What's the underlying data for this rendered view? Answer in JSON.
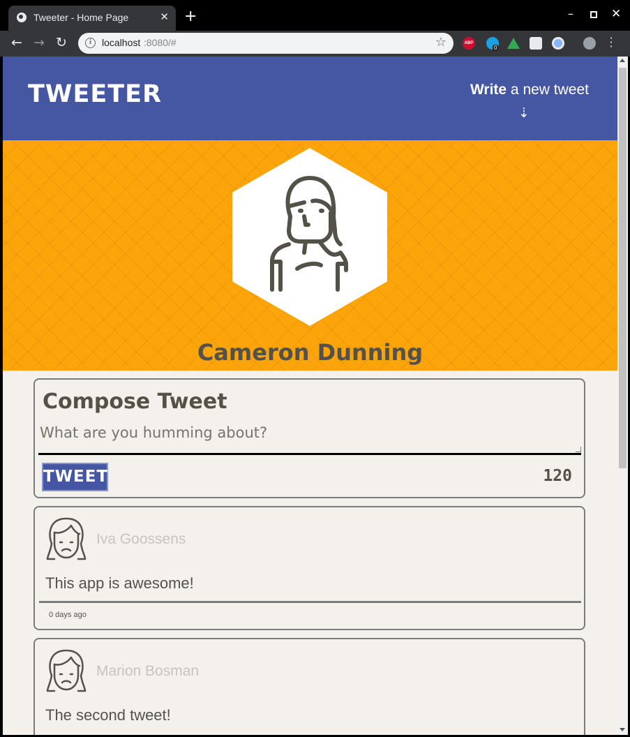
{
  "browser": {
    "tab_title": "Tweeter - Home Page",
    "tab_close": "✕",
    "new_tab": "+",
    "url_host": "localhost",
    "url_rest": ":8080/#",
    "ext_abp": "ABP",
    "ext_badge": "0"
  },
  "nav": {
    "logo": "TWEETER",
    "write_bold": "Write",
    "write_rest": " a new tweet",
    "arrow": "⇣"
  },
  "profile": {
    "name": "Cameron Dunning"
  },
  "compose": {
    "title": "Compose Tweet",
    "placeholder": "What are you humming about?",
    "button_label": "TWEET",
    "counter": "120"
  },
  "tweets": [
    {
      "user": "Iva Goossens",
      "text": "This app is awesome!",
      "time": "0 days ago"
    },
    {
      "user": "Marion Bosman",
      "text": "The second tweet!"
    }
  ],
  "colors": {
    "nav_bg": "#4556a3",
    "header_bg": "#fca50b",
    "page_bg": "#f4f1ec",
    "text": "#545149"
  }
}
